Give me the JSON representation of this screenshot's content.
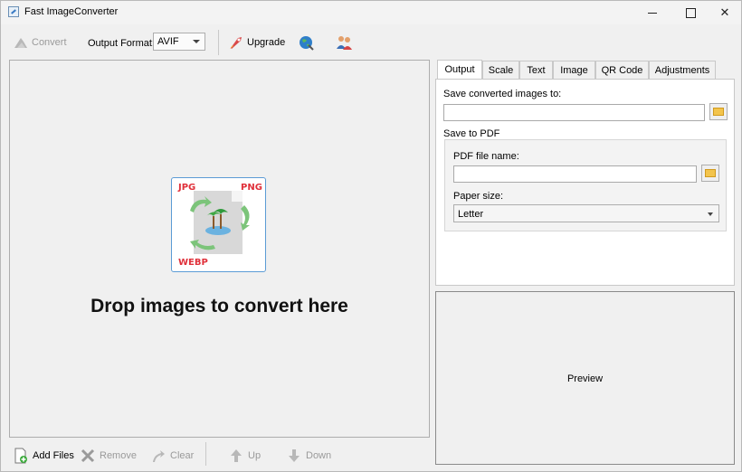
{
  "window": {
    "title": "Fast ImageConverter"
  },
  "toolbar": {
    "convert_label": "Convert",
    "output_format_label": "Output Format:",
    "output_format_value": "AVIF",
    "upgrade_label": "Upgrade"
  },
  "drop_area": {
    "badge_jpg": "JPG",
    "badge_png": "PNG",
    "badge_webp": "WEBP",
    "prompt": "Drop images to convert here"
  },
  "bottom_toolbar": {
    "add_files": "Add Files",
    "remove": "Remove",
    "clear": "Clear",
    "up": "Up",
    "down": "Down"
  },
  "tabs": [
    "Output",
    "Scale",
    "Text",
    "Image",
    "QR Code",
    "Adjustments"
  ],
  "output_tab": {
    "save_to_label": "Save converted images to:",
    "save_to_value": "",
    "save_pdf_label": "Save to PDF",
    "pdf_name_label": "PDF file name:",
    "pdf_name_value": "",
    "paper_size_label": "Paper size:",
    "paper_size_value": "Letter"
  },
  "preview": {
    "label": "Preview"
  },
  "colors": {
    "accent": "#5b9bd5",
    "format_badge": "#e0303a",
    "folder": "#f3c44c"
  }
}
